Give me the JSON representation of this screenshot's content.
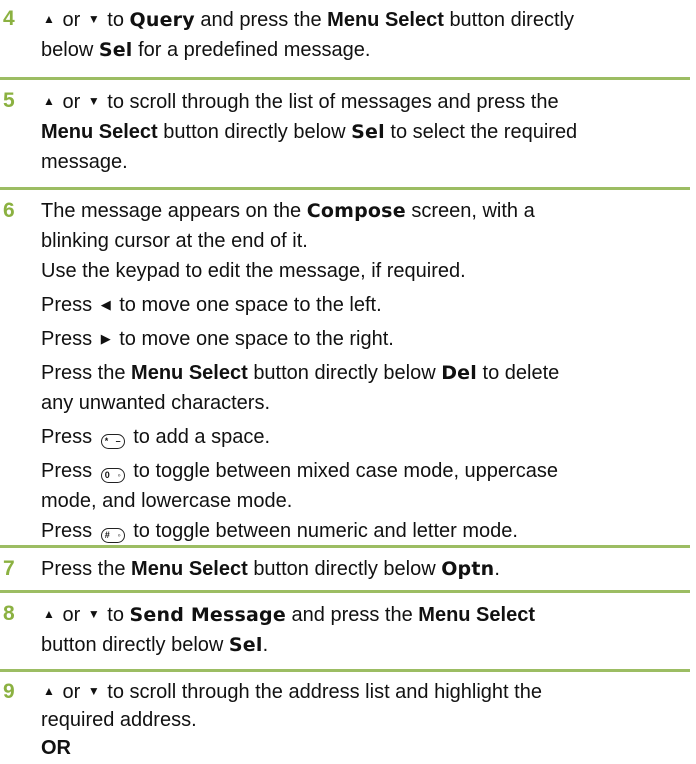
{
  "steps": [
    {
      "number": "4",
      "lines": [
        {
          "a": "or",
          "b": "to",
          "disp": "Query",
          "c": "and press the",
          "bold": "Menu Select",
          "d": "button directly"
        },
        {
          "a": "below",
          "disp": "Sel",
          "b": "for a predefined message."
        }
      ]
    },
    {
      "number": "5",
      "lines": [
        {
          "a": "or",
          "b": "to scroll through the list of messages and press the"
        },
        {
          "bold": "Menu Select",
          "a": "button directly below",
          "disp": "Sel",
          "b": "to select the required"
        },
        {
          "a": "message."
        }
      ]
    },
    {
      "number": "6",
      "lines": [
        {
          "a": "The message appears on the",
          "disp": "Compose",
          "b": "screen, with a"
        },
        {
          "a": "blinking cursor at the end of it."
        },
        {
          "a": "Use the keypad to edit the message, if required."
        },
        {
          "a": "Press",
          "b": "to move one space to the left."
        },
        {
          "a": "Press",
          "b": "to move one space to the right."
        },
        {
          "a": "Press the",
          "bold": "Menu Select",
          "b": "button directly below",
          "disp": "Del",
          "c": "to delete"
        },
        {
          "a": "any unwanted characters."
        },
        {
          "a": "Press",
          "b": "to add a space."
        },
        {
          "a": "Press",
          "b": "to toggle between mixed case mode, uppercase"
        },
        {
          "a": "mode, and lowercase mode."
        },
        {
          "a": "Press",
          "b": "to toggle between numeric and letter mode."
        }
      ]
    },
    {
      "number": "7",
      "lines": [
        {
          "a": "Press the",
          "bold": "Menu Select",
          "b": "button directly below",
          "disp": "Optn",
          "c": "."
        }
      ]
    },
    {
      "number": "8",
      "lines": [
        {
          "a": "or",
          "b": "to",
          "disp": "Send Message",
          "c": "and press the",
          "bold": "Menu Select"
        },
        {
          "a": "button directly below",
          "disp": "Sel",
          "b": "."
        }
      ]
    },
    {
      "number": "9",
      "lines": [
        {
          "a": "or",
          "b": "to scroll through the address list and highlight the"
        },
        {
          "a": "required address."
        },
        {
          "bold": "OR"
        }
      ]
    }
  ],
  "keys": {
    "star": "*",
    "zero": "0",
    "hash": "#"
  },
  "icons": {
    "up": "up-arrow-icon",
    "down": "down-arrow-icon",
    "left": "left-triangle-icon",
    "right": "right-triangle-icon"
  },
  "colors": {
    "step_number": "#8bb141",
    "rule": "#9cbd63"
  }
}
